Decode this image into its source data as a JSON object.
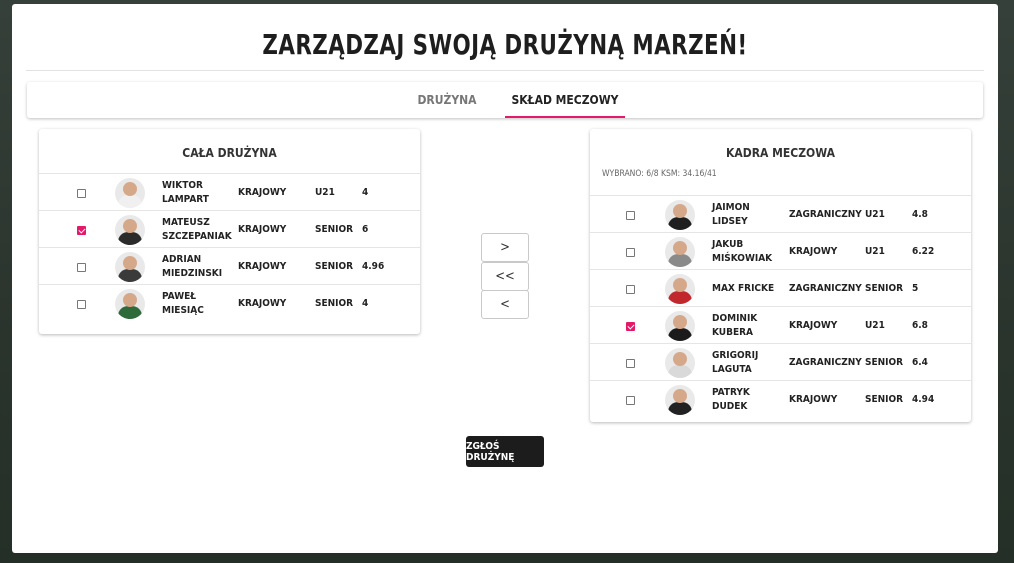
{
  "title": "ZARZĄDZAJ SWOJĄ DRUŻYNĄ MARZEŃ!",
  "tabs": [
    {
      "label": "DRUŻYNA",
      "active": false
    },
    {
      "label": "SKŁAD MECZOWY",
      "active": true
    }
  ],
  "accent_color": "#e5196a",
  "left_panel": {
    "title": "CAŁA DRUŻYNA",
    "rows": [
      {
        "name": "WIKTOR LAMPART",
        "origin": "KRAJOWY",
        "category": "U21",
        "value": "4",
        "checked": false,
        "avatar_color": "#f0f0f0"
      },
      {
        "name": "MATEUSZ SZCZEPANIAK",
        "origin": "KRAJOWY",
        "category": "SENIOR",
        "value": "6",
        "checked": true,
        "avatar_color": "#2b2b2b"
      },
      {
        "name": "ADRIAN MIEDZINSKI",
        "origin": "KRAJOWY",
        "category": "SENIOR",
        "value": "4.96",
        "checked": false,
        "avatar_color": "#3a3a3a"
      },
      {
        "name": "PAWEŁ MIESIĄC",
        "origin": "KRAJOWY",
        "category": "SENIOR",
        "value": "4",
        "checked": false,
        "avatar_color": "#2f6a3a"
      }
    ]
  },
  "transfer_buttons": [
    ">",
    "<<",
    "<"
  ],
  "right_panel": {
    "title": "KADRA MECZOWA",
    "subtitle": "WYBRANO: 6/8 KSM: 34.16/41",
    "rows": [
      {
        "name": "JAIMON LIDSEY",
        "origin": "ZAGRANICZNY",
        "category": "U21",
        "value": "4.8",
        "checked": false,
        "avatar_color": "#1f1f1f"
      },
      {
        "name": "JAKUB MIŚKOWIAK",
        "origin": "KRAJOWY",
        "category": "U21",
        "value": "6.22",
        "checked": false,
        "avatar_color": "#8a8a8a"
      },
      {
        "name": "MAX FRICKE",
        "origin": "ZAGRANICZNY",
        "category": "SENIOR",
        "value": "5",
        "checked": false,
        "avatar_color": "#c0282d"
      },
      {
        "name": "DOMINIK KUBERA",
        "origin": "KRAJOWY",
        "category": "U21",
        "value": "6.8",
        "checked": true,
        "avatar_color": "#1b1b1b"
      },
      {
        "name": "GRIGORIJ LAGUTA",
        "origin": "ZAGRANICZNY",
        "category": "SENIOR",
        "value": "6.4",
        "checked": false,
        "avatar_color": "#d9d9d9"
      },
      {
        "name": "PATRYK DUDEK",
        "origin": "KRAJOWY",
        "category": "SENIOR",
        "value": "4.94",
        "checked": false,
        "avatar_color": "#222222"
      }
    ]
  },
  "submit_label": "ZGŁOŚ DRUŻYNĘ"
}
